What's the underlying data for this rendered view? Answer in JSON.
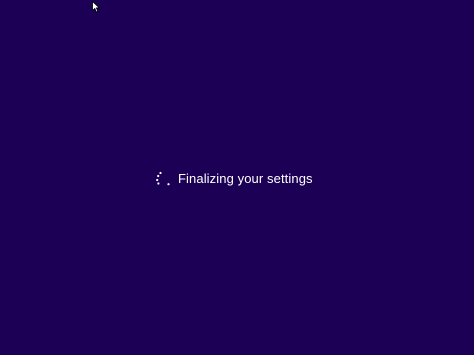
{
  "screen": {
    "background_color": "#1b0055",
    "foreground_color": "#ffffff"
  },
  "cursor": {
    "icon": "mouse-pointer-icon"
  },
  "status": {
    "spinner_icon": "loading-spinner-icon",
    "message": "Finalizing your settings"
  }
}
